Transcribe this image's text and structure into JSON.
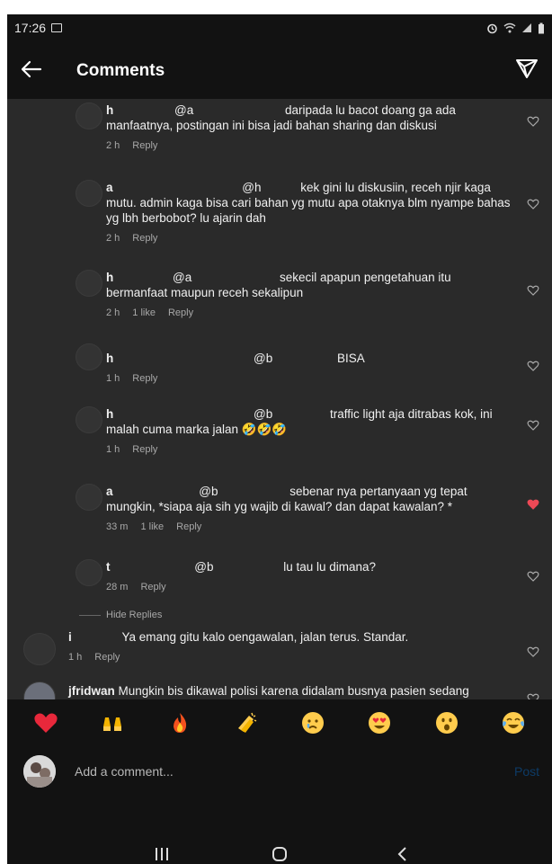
{
  "status_bar": {
    "time": "17:26"
  },
  "header": {
    "title": "Comments"
  },
  "comments": [
    {
      "user": "h",
      "mention": "@a",
      "text": "daripada lu bacot doang ga ada manfaatnya, postingan ini bisa jadi bahan sharing dan diskusi",
      "time": "2 h",
      "likes": "",
      "reply": "Reply",
      "liked": false
    },
    {
      "user": "a",
      "mention": "@h",
      "text": "kek gini lu diskusiin, receh njir kaga mutu. admin kaga bisa cari bahan yg mutu apa otaknya blm nyampe bahas yg lbh berbobot? lu ajarin dah",
      "time": "2 h",
      "likes": "",
      "reply": "Reply",
      "liked": false
    },
    {
      "user": "h",
      "mention": "@a",
      "text": "sekecil apapun pengetahuan itu bermanfaat maupun receh sekalipun",
      "time": "2 h",
      "likes": "1 like",
      "reply": "Reply",
      "liked": false
    },
    {
      "user": "h",
      "mention": "@b",
      "text": "BISA",
      "time": "1 h",
      "likes": "",
      "reply": "Reply",
      "liked": false
    },
    {
      "user": "h",
      "mention": "@b",
      "text": "traffic light aja ditrabas kok, ini malah cuma marka jalan 🤣🤣🤣",
      "time": "1 h",
      "likes": "",
      "reply": "Reply",
      "liked": false
    },
    {
      "user": "a",
      "mention": "@b",
      "text": "sebenar nya pertanyaan yg tepat mungkin, *siapa aja sih yg wajib di kawal? dan dapat kawalan? *",
      "time": "33 m",
      "likes": "1 like",
      "reply": "Reply",
      "liked": true
    },
    {
      "user": "t",
      "mention": "@b",
      "text": "lu tau lu dimana?",
      "time": "28 m",
      "likes": "",
      "reply": "Reply",
      "liked": false
    }
  ],
  "hide_replies": "Hide Replies",
  "top_comments": [
    {
      "user": "i",
      "text": "Ya emang gitu kalo oengawalan, jalan terus. Standar.",
      "time": "1 h",
      "reply": "Reply"
    },
    {
      "user": "jfridwan",
      "text": "Mungkin bis dikawal polisi karena didalam busnya pasien sedang"
    }
  ],
  "reactions": [
    "red-heart",
    "raising-hands",
    "fire",
    "clapping-hands",
    "crying-face",
    "heart-eyes",
    "surprised-face",
    "tears-of-joy"
  ],
  "composer": {
    "placeholder": "Add a comment...",
    "post_label": "Post"
  },
  "colors": {
    "background": "#2a2a2a",
    "bar": "#121212",
    "liked_heart": "#ed4956",
    "post_disabled": "#0d3b66"
  }
}
